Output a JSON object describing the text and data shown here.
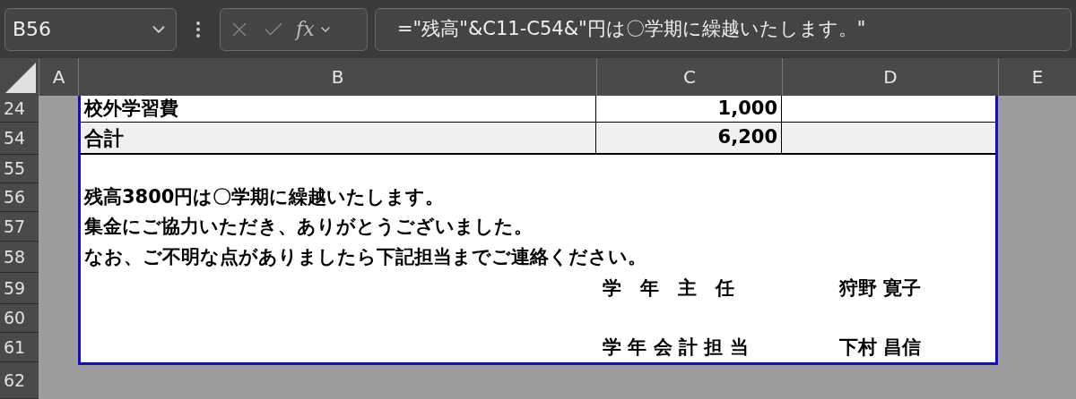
{
  "name_box": {
    "value": "B56"
  },
  "function_button": {
    "label": "fx"
  },
  "formula_bar": {
    "value": "=\"残高\"&C11-C54&\"円は〇学期に繰越いたします。\""
  },
  "column_headers": [
    "A",
    "B",
    "C",
    "D",
    "E"
  ],
  "row_headers": [
    "24",
    "54",
    "55",
    "56",
    "57",
    "58",
    "59",
    "60",
    "61",
    "62"
  ],
  "table_rows": [
    {
      "item": "校外学習費",
      "amount": "1,000",
      "total": false
    },
    {
      "item": "合計",
      "amount": "6,200",
      "total": true
    }
  ],
  "notes": [
    "残高3800円は〇学期に繰越いたします。",
    "集金にご協力いただき、ありがとうございました。",
    "なお、ご不明な点がありましたら下記担当までご連絡ください。"
  ],
  "signatures": [
    {
      "role": "学　年　主　任",
      "name": "狩野 寛子"
    },
    {
      "role": "学 年 会 計 担 当",
      "name": "下村 昌信"
    }
  ]
}
